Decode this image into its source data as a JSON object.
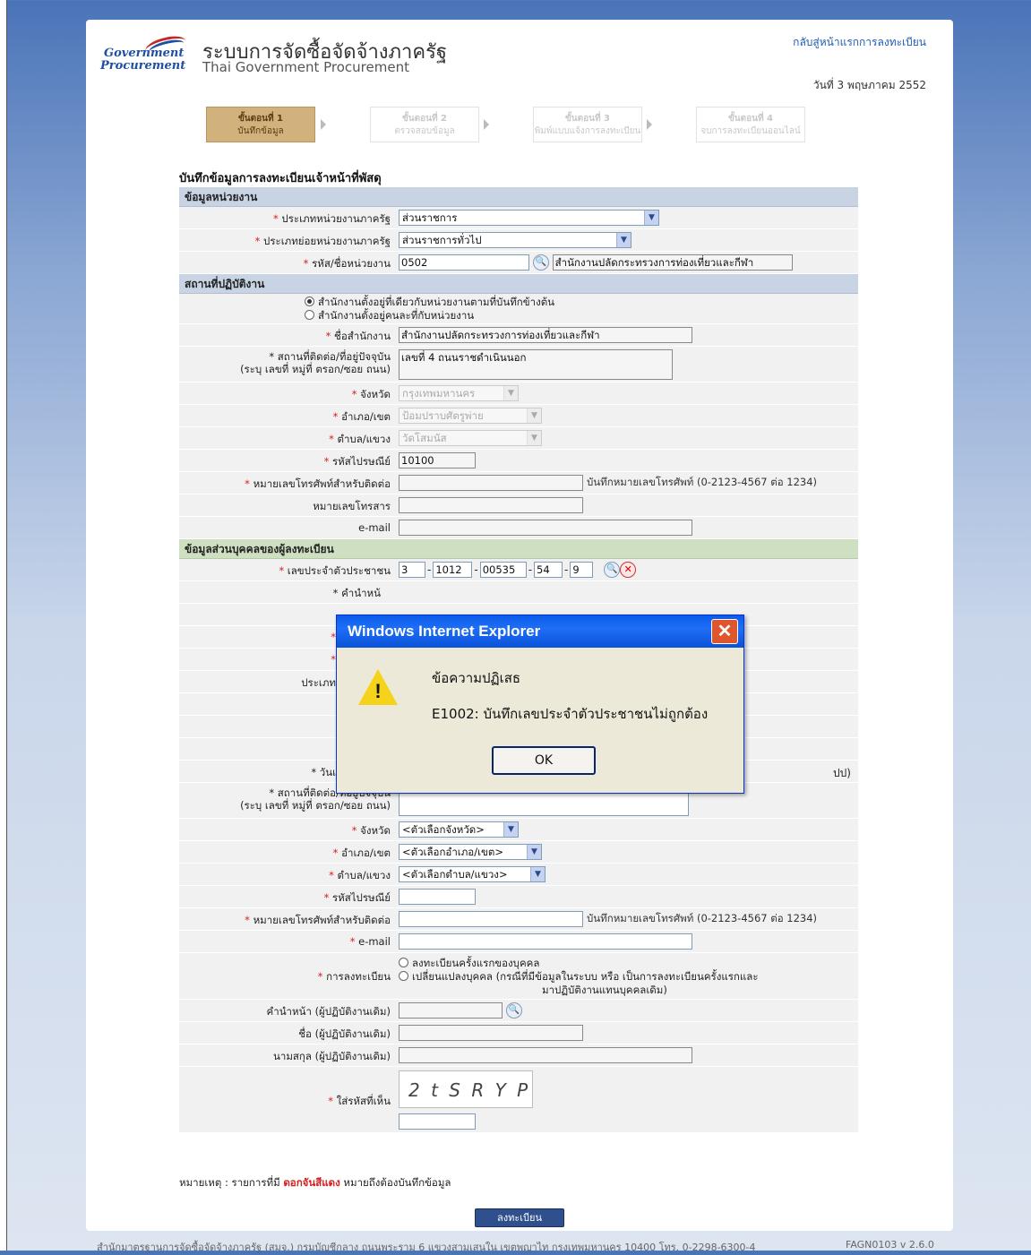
{
  "header": {
    "logo_line1": "Government",
    "logo_line2": "Procurement",
    "title_th": "ระบบการจัดซื้อจัดจ้างภาครัฐ",
    "title_en": "Thai Government Procurement",
    "top_link": "กลับสู่หน้าแรกการลงทะเบียน",
    "date": "วันที่ 3 พฤษภาคม 2552"
  },
  "steps": [
    {
      "t1": "ขั้นตอนที่ 1",
      "t2": "บันทึกข้อมูล"
    },
    {
      "t1": "ขั้นตอนที่ 2",
      "t2": "ตรวจสอบข้อมูล"
    },
    {
      "t1": "ขั้นตอนที่ 3",
      "t2": "พิมพ์แบบแจ้งการลงทะเบียน"
    },
    {
      "t1": "ขั้นตอนที่ 4",
      "t2": "จบการลงทะเบียนออนไลน์"
    }
  ],
  "form_title": "บันทึกข้อมูลการลงทะเบียนเจ้าหน้าที่พัสดุ",
  "sections": {
    "agency": "ข้อมูลหน่วยงาน",
    "workplace": "สถานที่ปฏิบัติงาน",
    "personal": "ข้อมูลส่วนบุคคลของผู้ลงทะเบียน"
  },
  "agency": {
    "type_label": "ประเภทหน่วยงานภาครัฐ",
    "type_value": "ส่วนราชการ",
    "subtype_label": "ประเภทย่อยหน่วยงานภาครัฐ",
    "subtype_value": "ส่วนราชการทั่วไป",
    "code_label": "รหัส/ชื่อหน่วยงาน",
    "code_value": "0502",
    "name_value": "สำนักงานปลัดกระทรวงการท่องเที่ยวและกีฬา"
  },
  "workplace": {
    "radio1": "สำนักงานตั้งอยู่ที่เดียวกับหน่วยงานตามที่บันทึกข้างต้น",
    "radio2": "สำนักงานตั้งอยู่คนละที่กับหน่วยงาน",
    "office_label": "ชื่อสำนักงาน",
    "office_value": "สำนักงานปลัดกระทรวงการท่องเที่ยวและกีฬา",
    "address_label": "สถานที่ติดต่อ/ที่อยู่ปัจจุบัน",
    "address_sub": "(ระบุ เลขที่ หมู่ที่ ตรอก/ซอย ถนน)",
    "address_value": "เลขที่ 4  ถนนราชดำเนินนอก",
    "province_label": "จังหวัด",
    "province_value": "กรุงเทพมหานคร",
    "district_label": "อำเภอ/เขต",
    "district_value": "ป้อมปราบศัตรูพ่าย",
    "subdistrict_label": "ตำบล/แขวง",
    "subdistrict_value": "วัดโสมนัส",
    "postcode_label": "รหัสไปรษณีย์",
    "postcode_value": "10100",
    "phone_label": "หมายเลขโทรศัพท์สำหรับติดต่อ",
    "phone_hint": "บันทึกหมายเลขโทรศัพท์ (0-2123-4567 ต่อ 1234)",
    "fax_label": "หมายเลขโทรสาร",
    "email_label": "e-mail"
  },
  "personal": {
    "id_label": "เลขประจำตัวประชาชน",
    "id_parts": [
      "3",
      "1012",
      "00535",
      "54",
      "9"
    ],
    "prefix_fragment": "* คำนำหน้",
    "type_fragment": "ประเภท",
    "birth_fragment": "* วันเ",
    "birth_hint_fragment": "ปป)",
    "address_label": "สถานที่ติดต่อ/ที่อยู่ปัจจุบัน",
    "address_sub": "(ระบุ เลขที่ หมู่ที่ ตรอก/ซอย ถนน)",
    "province_label": "จังหวัด",
    "province_value": "<ตัวเลือกจังหวัด>",
    "district_label": "อำเภอ/เขต",
    "district_value": "<ตัวเลือกอำเภอ/เขต>",
    "subdistrict_label": "ตำบล/แขวง",
    "subdistrict_value": "<ตัวเลือกตำบล/แขวง>",
    "postcode_label": "รหัสไปรษณีย์",
    "phone_label": "หมายเลขโทรศัพท์สำหรับติดต่อ",
    "phone_hint": "บันทึกหมายเลขโทรศัพท์ (0-2123-4567 ต่อ 1234)",
    "email_label": "e-mail",
    "reg_label": "การลงทะเบียน",
    "reg_opt1": "ลงทะเบียนครั้งแรกของบุคคล",
    "reg_opt2a": "เปลี่ยนแปลงบุคคล (กรณีที่มีข้อมูลในระบบ หรือ เป็นการลงทะเบียนครั้งแรกและ",
    "reg_opt2b": "มาปฏิบัติงานแทนบุคคลเดิม)",
    "old_prefix_label": "คำนำหน้า (ผู้ปฏิบัติงานเดิม)",
    "old_name_label": "ชื่อ (ผู้ปฏิบัติงานเดิม)",
    "old_surname_label": "นามสกุล (ผู้ปฏิบัติงานเดิม)",
    "captcha_label": "ใส่รหัสที่เห็น",
    "captcha_text": "2 t S R Y P"
  },
  "note": {
    "prefix": "หมายเหตุ : รายการที่มี ",
    "red": "ดอกจันสีแดง",
    "suffix": " หมายถึงต้องบันทึกข้อมูล"
  },
  "submit_label": "ลงทะเบียน",
  "footer": "สำนักมาตรฐานการจัดซื้อจัดจ้างภาครัฐ (สมจ.) กรมบัญชีกลาง ถนนพระราม 6 แขวงสามเสนใน เขตพญาไท กรุงเทพมหานคร 10400 โทร. 0-2298-6300-4",
  "version": "FAGN0103 v 2.6.0",
  "dialog": {
    "title": "Windows Internet Explorer",
    "heading": "ข้อความปฏิเสธ",
    "message": "E1002: บันทึกเลขประจำตัวประชาชนไม่ถูกต้อง",
    "ok": "OK"
  },
  "colors": {
    "accent": "#1e5cb3",
    "required": "#d32020",
    "step_active": "#d2b27c"
  },
  "icons": [
    "search-icon",
    "clear-icon",
    "warning-icon",
    "close-icon",
    "chevron-down-icon"
  ]
}
